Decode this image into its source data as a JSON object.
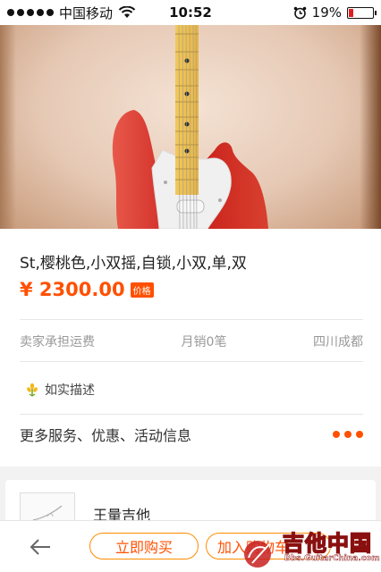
{
  "status_bar": {
    "carrier": "中国移动",
    "time": "10:52",
    "battery_percent": "19%",
    "battery_level": 0.19
  },
  "product": {
    "title": "St,樱桃色,小双摇,自锁,小双,单,双",
    "price": "¥ 2300.00",
    "price_tag": "价格",
    "shipping": "卖家承担运费",
    "monthly_sales": "月销0笔",
    "location": "四川成都",
    "description_badge": "如实描述",
    "more_services": "更多服务、优惠、活动信息"
  },
  "shop": {
    "name": "王量吉他"
  },
  "bottom_bar": {
    "buy_now": "立即购买",
    "add_to_cart": "加入购物车"
  },
  "watermark": {
    "title": "吉他中国",
    "url": "Bbs.GuitarChina.com"
  },
  "colors": {
    "accent": "#ff5000",
    "button_border": "#ff8c00",
    "battery_low": "#e02020"
  }
}
